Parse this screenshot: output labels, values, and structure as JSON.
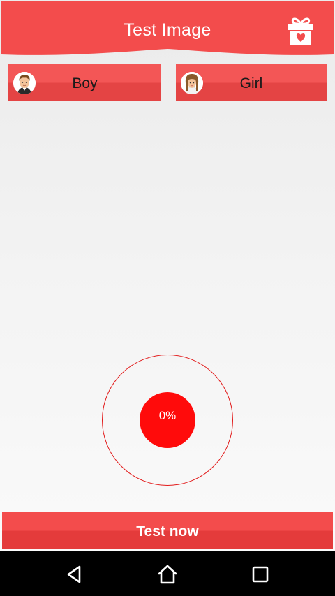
{
  "header": {
    "title": "Test Image",
    "gift_icon": "gift-heart-icon"
  },
  "gender": {
    "boy": {
      "label": "Boy",
      "icon": "boy-avatar-icon"
    },
    "girl": {
      "label": "Girl",
      "icon": "girl-avatar-icon"
    }
  },
  "gauge": {
    "progress_text": "0%",
    "progress_value": 0
  },
  "actions": {
    "test_label": "Test now"
  },
  "navbar": {
    "icons": [
      "back-icon",
      "home-icon",
      "recents-icon"
    ]
  },
  "colors": {
    "accent": "#f34c4c",
    "accent_dark": "#e43b3b",
    "gauge_core": "#ff0b0b",
    "navbar": "#000000"
  }
}
